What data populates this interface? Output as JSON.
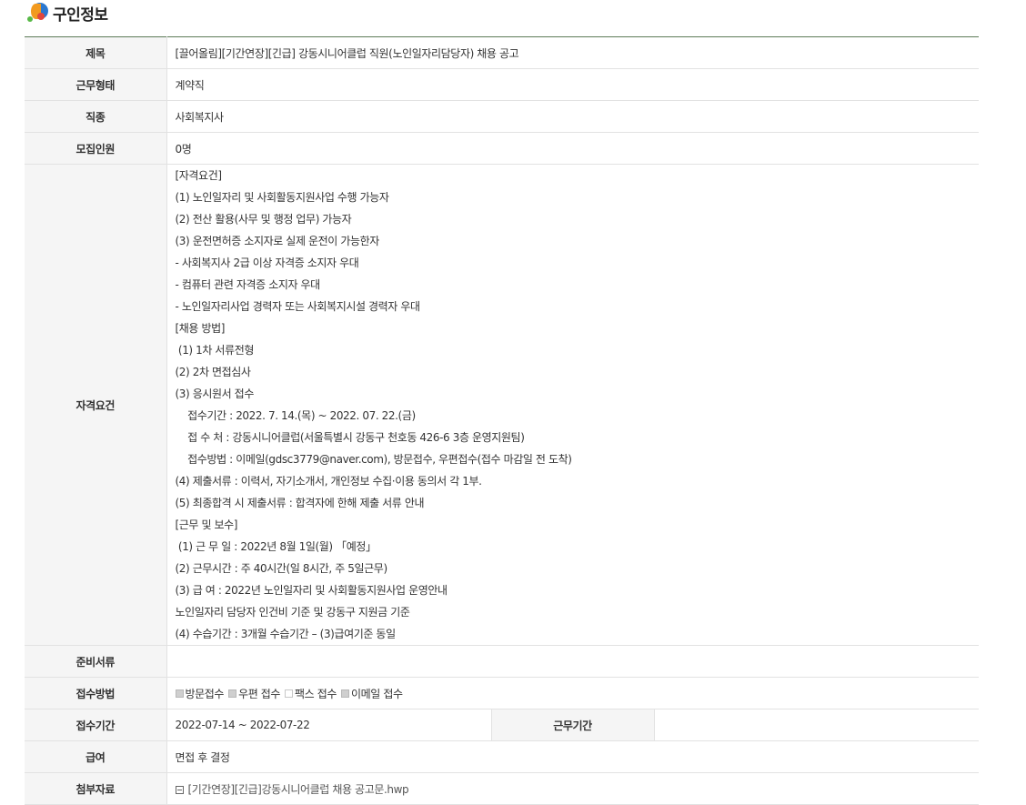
{
  "section_title": "구인정보",
  "rows": {
    "title": {
      "label": "제목",
      "value": "[끌어올림][기간연장][긴급] 강동시니어클럽 직원(노인일자리담당자) 채용 공고"
    },
    "work_type": {
      "label": "근무형태",
      "value": "계약직"
    },
    "job_category": {
      "label": "직종",
      "value": "사회복지사"
    },
    "headcount": {
      "label": "모집인원",
      "value": "0명"
    },
    "requirements": {
      "label": "자격요건",
      "lines": [
        "[자격요건]",
        "(1) 노인일자리 및 사회활동지원사업 수행 가능자",
        "(2) 전산 활용(사무 및 행정 업무) 가능자",
        "(3) 운전면허증 소지자로 실제 운전이 가능한자",
        "- 사회복지사 2급 이상 자격증 소지자 우대",
        "- 컴퓨터 관련 자격증 소지자 우대",
        "- 노인일자리사업 경력자 또는 사회복지시설 경력자 우대",
        "[채용 방법]",
        " (1) 1차 서류전형",
        "(2) 2차 면접심사",
        "(3) 응시원서 접수",
        "    접수기간 : 2022. 7. 14.(목) ~ 2022. 07. 22.(금)",
        "    접 수 처 : 강동시니어클럽(서울특별시 강동구 천호동 426-6 3층 운영지원팀)",
        "    접수방법 : 이메일(gdsc3779@naver.com), 방문접수, 우편접수(접수 마감일 전 도착)",
        "(4) 제출서류 : 이력서, 자기소개서, 개인정보 수집·이용 동의서 각 1부.",
        "(5) 최종합격 시 제출서류 : 합격자에 한해 제출 서류 안내",
        "[근무 및 보수]",
        " (1) 근 무 일 : 2022년 8월 1일(월) 「예정」",
        "(2) 근무시간 : 주 40시간(일 8시간, 주 5일근무)",
        "(3) 급 여 : 2022년 노인일자리 및 사회활동지원사업 운영안내",
        "노인일자리 담당자 인건비 기준 및 강동구 지원금 기준",
        "(4) 수습기간 : 3개월 수습기간 – (3)급여기준 동일"
      ]
    },
    "documents": {
      "label": "준비서류",
      "value": ""
    },
    "application_method": {
      "label": "접수방법",
      "options": [
        {
          "label": "방문접수",
          "checked": true
        },
        {
          "label": "우편 접수",
          "checked": true
        },
        {
          "label": "팩스 접수",
          "checked": false
        },
        {
          "label": "이메일 접수",
          "checked": true
        }
      ]
    },
    "application_period": {
      "label": "접수기간",
      "value": "2022-07-14 ~ 2022-07-22",
      "work_period_label": "근무기간",
      "work_period_value": ""
    },
    "salary": {
      "label": "급여",
      "value": "면접 후 결정"
    },
    "attachment": {
      "label": "첨부자료",
      "file_name": "[기간연장][긴급]강동시니어클럽 채용 공고문.hwp"
    }
  }
}
